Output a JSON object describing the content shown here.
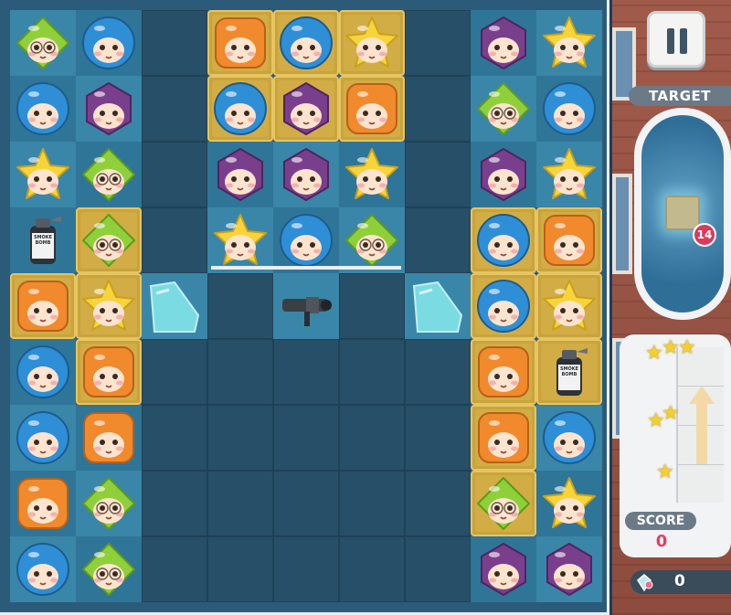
{
  "board": {
    "rows": [
      [
        "green",
        "blue",
        "empty",
        "orange",
        "blue",
        "yellow",
        "empty",
        "purple",
        "yellow"
      ],
      [
        "blue",
        "purple",
        "empty",
        "blue",
        "purple",
        "orange",
        "empty",
        "green",
        "blue"
      ],
      [
        "yellow",
        "green",
        "empty",
        "purple",
        "purple",
        "yellow",
        "empty",
        "purple",
        "yellow"
      ],
      [
        "smoke_bomb",
        "green",
        "empty",
        "yellow",
        "blue",
        "green",
        "empty",
        "blue",
        "orange"
      ],
      [
        "orange",
        "yellow",
        "ice",
        "dark",
        "rocket",
        "dark",
        "ice",
        "blue",
        "yellow"
      ],
      [
        "blue",
        "orange",
        "dark",
        "dark",
        "dark",
        "dark",
        "dark",
        "orange",
        "smoke_bomb"
      ],
      [
        "blue",
        "orange",
        "dark",
        "dark",
        "dark",
        "dark",
        "dark",
        "orange",
        "blue"
      ],
      [
        "orange",
        "green",
        "dark",
        "dark",
        "dark",
        "dark",
        "dark",
        "green",
        "yellow"
      ],
      [
        "blue",
        "green",
        "dark",
        "dark",
        "dark",
        "dark",
        "dark",
        "purple",
        "purple"
      ]
    ],
    "gold_tiles": [
      [
        0,
        3
      ],
      [
        0,
        4
      ],
      [
        0,
        5
      ],
      [
        1,
        3
      ],
      [
        1,
        4
      ],
      [
        1,
        5
      ],
      [
        3,
        1
      ],
      [
        3,
        7
      ],
      [
        3,
        8
      ],
      [
        4,
        0
      ],
      [
        4,
        1
      ],
      [
        4,
        7
      ],
      [
        4,
        8
      ],
      [
        5,
        1
      ],
      [
        5,
        7
      ],
      [
        5,
        8
      ],
      [
        6,
        7
      ],
      [
        7,
        7
      ]
    ],
    "smoke_bomb_text": "M18\nSMOKE\nBOMB"
  },
  "side": {
    "pause_label": "pause",
    "target_label": "TARGET",
    "target_count": "14",
    "score_label": "SCORE",
    "score_value": "0",
    "stars_earned": 0,
    "gem_count": "0"
  },
  "colors": {
    "orange": "#f08a2c",
    "blue": "#2f8fd6",
    "yellow": "#f7d43a",
    "green": "#8fd03a",
    "purple": "#7a3f8c",
    "target_badge": "#d93a5d"
  },
  "icons": [
    "pause-icon",
    "target-icon",
    "star-icon",
    "gem-icon",
    "smoke-bomb-icon",
    "rocket-icon"
  ]
}
